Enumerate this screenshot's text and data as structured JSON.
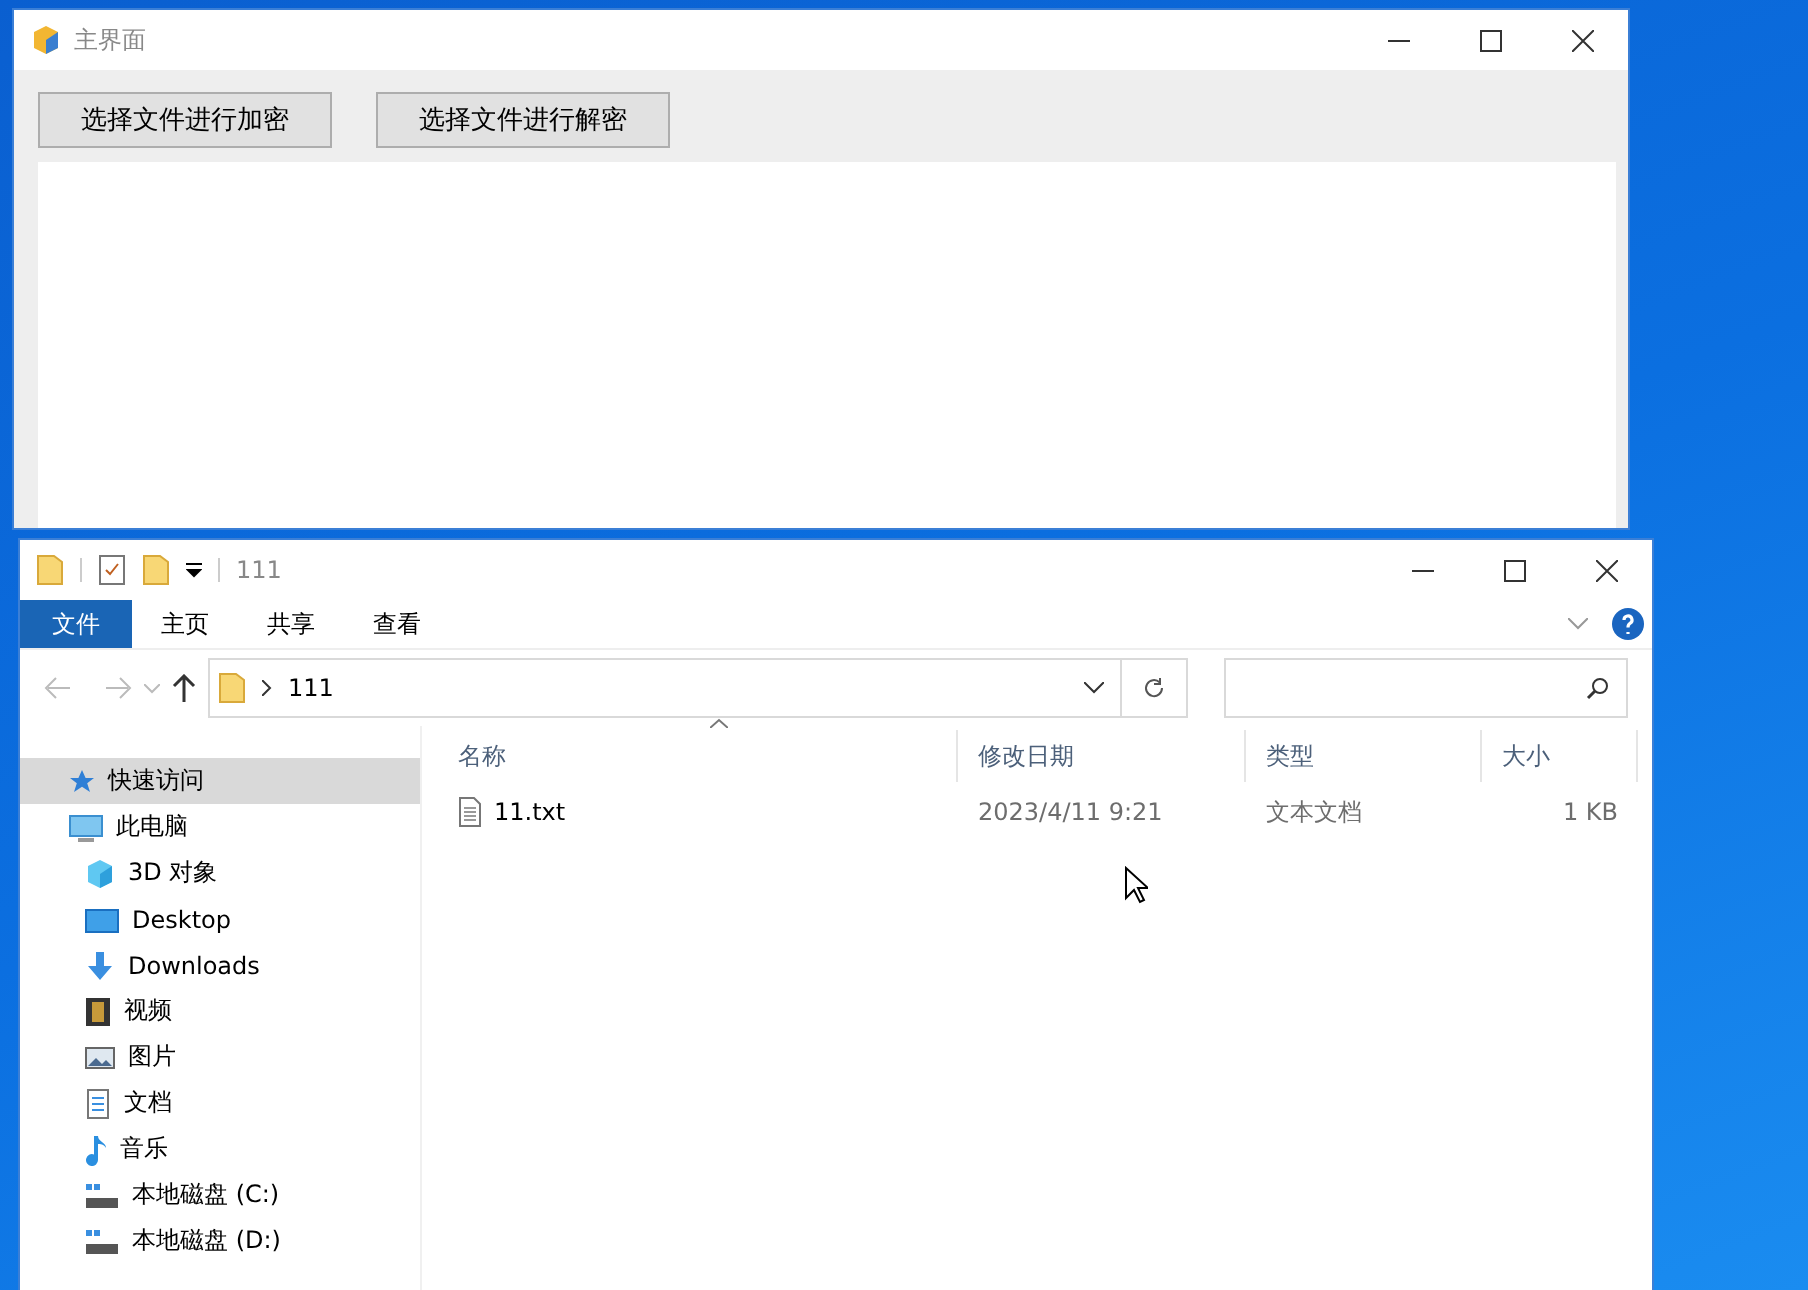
{
  "main_window": {
    "title": "主界面",
    "buttons": [
      "选择文件进行加密",
      "选择文件进行解密"
    ]
  },
  "explorer": {
    "title": "111",
    "ribbon_tabs": [
      {
        "label": "文件",
        "selected": true
      },
      {
        "label": "主页",
        "selected": false
      },
      {
        "label": "共享",
        "selected": false
      },
      {
        "label": "查看",
        "selected": false
      }
    ],
    "address": "111",
    "sidebar": {
      "items": [
        {
          "label": "快速访问",
          "kind": "star",
          "selected": true
        },
        {
          "label": "此电脑",
          "kind": "pc",
          "selected": false,
          "children": [
            {
              "label": "3D 对象",
              "kind": "cube",
              "selected": false
            },
            {
              "label": "Desktop",
              "kind": "desktop",
              "selected": false
            },
            {
              "label": "Downloads",
              "kind": "download",
              "selected": false
            },
            {
              "label": "视频",
              "kind": "video",
              "selected": false
            },
            {
              "label": "图片",
              "kind": "picture",
              "selected": false
            },
            {
              "label": "文档",
              "kind": "document",
              "selected": false
            },
            {
              "label": "音乐",
              "kind": "music",
              "selected": false
            },
            {
              "label": "本地磁盘 (C:)",
              "kind": "drive",
              "selected": false
            },
            {
              "label": "本地磁盘 (D:)",
              "kind": "drive",
              "selected": false
            }
          ]
        }
      ]
    },
    "table": {
      "columns": [
        "名称",
        "修改日期",
        "类型",
        "大小"
      ],
      "rows": [
        {
          "name": "11.txt",
          "modified": "2023/4/11 9:21",
          "type": "文本文档",
          "size": "1 KB"
        }
      ]
    }
  }
}
